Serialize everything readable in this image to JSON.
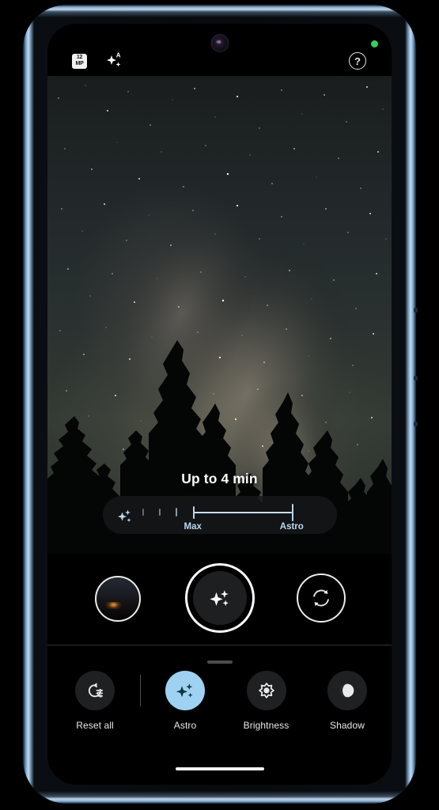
{
  "device": {
    "frame_color": "#c4daee",
    "screen_background": "#000000"
  },
  "top_bar": {
    "resolution_badge": {
      "line1": "12",
      "line2": "MP",
      "icon": "resolution-badge-icon"
    },
    "auto_enhance_icon": "sparkle-auto-icon",
    "help_icon": "help-question-icon",
    "help_label": "?",
    "camera_active_dot": "green-privacy-dot"
  },
  "viewfinder": {
    "scene": "milky-way-night-sky-with-pine-tree-silhouettes",
    "accent": "#b7d7ee"
  },
  "exposure": {
    "label": "Up to 4 min",
    "slider_icon": "sparkle-astro-icon",
    "ticks": [
      {
        "position_pct": 0,
        "height": 9,
        "opacity": 0.45
      },
      {
        "position_pct": 9,
        "height": 9,
        "opacity": 0.55
      },
      {
        "position_pct": 18,
        "height": 11,
        "opacity": 0.7
      },
      {
        "position_pct": 27,
        "height": 16,
        "opacity": 1.0
      },
      {
        "position_pct": 80,
        "height": 22,
        "opacity": 1.0
      }
    ],
    "line": {
      "from_pct": 27,
      "to_pct": 80
    },
    "captions": [
      {
        "text": "Max",
        "position_pct": 27
      },
      {
        "text": "Astro",
        "position_pct": 80
      }
    ],
    "selected": "Astro"
  },
  "shutter_row": {
    "thumbnail": {
      "name": "last-photo-thumbnail",
      "scene": "sunset-horizon"
    },
    "shutter": {
      "name": "shutter-button",
      "icon": "sparkle-astro-icon"
    },
    "flip_camera": {
      "name": "flip-camera-button",
      "icon": "camera-flip-icon"
    }
  },
  "tools": [
    {
      "id": "reset-all",
      "label": "Reset all",
      "icon": "reset-settings-icon",
      "active": false
    },
    {
      "id": "astro",
      "label": "Astro",
      "icon": "sparkle-astro-icon",
      "active": true
    },
    {
      "id": "brightness",
      "label": "Brightness",
      "icon": "brightness-sun-icon",
      "active": false
    },
    {
      "id": "shadow",
      "label": "Shadow",
      "icon": "contrast-moon-icon",
      "active": false
    }
  ],
  "colors": {
    "accent_blue": "#9ed1f2",
    "slider_blue": "#b7d7ee",
    "icon_dark": "#10343f",
    "sheet_bg": "#000000",
    "tool_circle_bg": "#1e2022"
  },
  "home_indicator": "home-gesture-bar"
}
